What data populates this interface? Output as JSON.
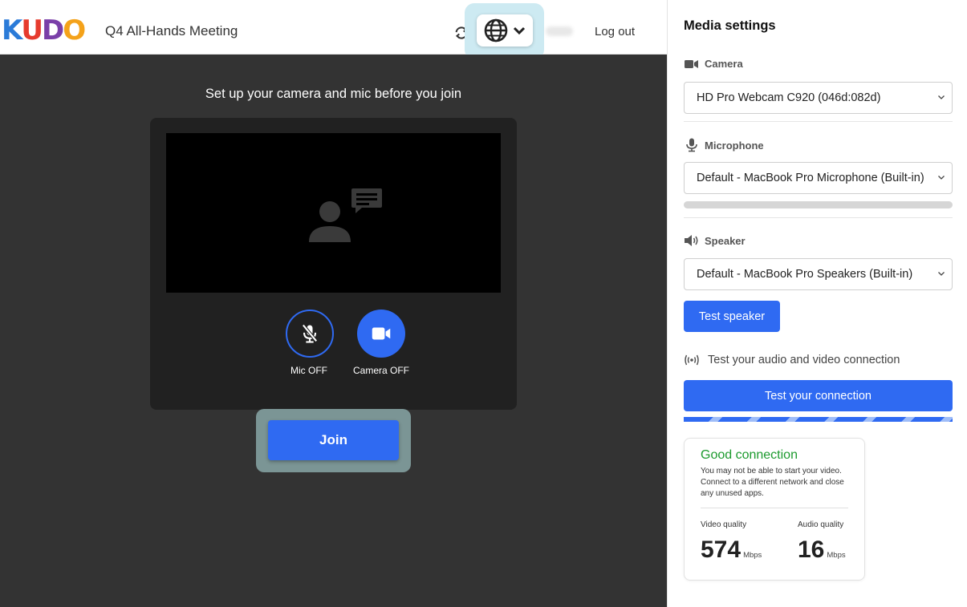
{
  "header": {
    "logo_letters": [
      {
        "char": "K",
        "color": "#2b7bd8"
      },
      {
        "char": "U",
        "color": "#e63b2e"
      },
      {
        "char": "D",
        "color": "#7a3fa8"
      },
      {
        "char": "O",
        "color": "#f4a21a"
      }
    ],
    "meeting_title": "Q4 All-Hands Meeting",
    "logout_label": "Log out"
  },
  "main": {
    "setup_heading": "Set up your camera and mic before you join",
    "mic_label": "Mic OFF",
    "camera_label": "Camera OFF",
    "join_label": "Join"
  },
  "panel": {
    "title": "Media settings",
    "camera": {
      "label": "Camera",
      "selected": "HD Pro Webcam C920 (046d:082d)"
    },
    "microphone": {
      "label": "Microphone",
      "selected": "Default - MacBook Pro Microphone (Built-in)",
      "level": 0
    },
    "speaker": {
      "label": "Speaker",
      "selected": "Default - MacBook Pro Speakers (Built-in)",
      "test_label": "Test speaker"
    },
    "connection": {
      "test_av_label": "Test your audio and video connection",
      "test_button_label": "Test your connection"
    },
    "result": {
      "title": "Good connection",
      "description": "You may not be able to start your video. Connect to a different network and close any unused apps.",
      "video_quality_label": "Video quality",
      "video_quality_value": "574",
      "video_quality_unit": "Mbps",
      "audio_quality_label": "Audio quality",
      "audio_quality_value": "16",
      "audio_quality_unit": "Mbps"
    }
  },
  "colors": {
    "accent": "#2f6af2",
    "good": "#1c9a2e",
    "dark_bg": "#333333"
  }
}
